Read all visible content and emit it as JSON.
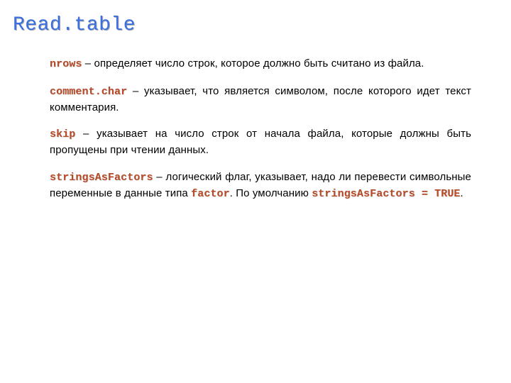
{
  "title": "Read.table",
  "items": [
    {
      "keyword": "nrows",
      "dash": " – ",
      "desc": " определяет число строк, которое должно быть считано из файла."
    },
    {
      "keyword": "comment.char",
      "dash": " – ",
      "desc": " указывает, что является символом, после которого идет текст комментария."
    },
    {
      "keyword": "skip",
      "dash": " – ",
      "desc": " указывает на число строк от начала файла, которые должны быть пропущены при чтении данных."
    }
  ],
  "complex": {
    "keyword": "stringsAsFactors",
    "dash": " – ",
    "part1": " логический флаг, указывает, надо ли перевести символьные переменные в данные типа ",
    "kw2": "factor",
    "part2": ". По умолчанию ",
    "kw3": "stringsAsFactors = TRUE",
    "part3": "."
  }
}
